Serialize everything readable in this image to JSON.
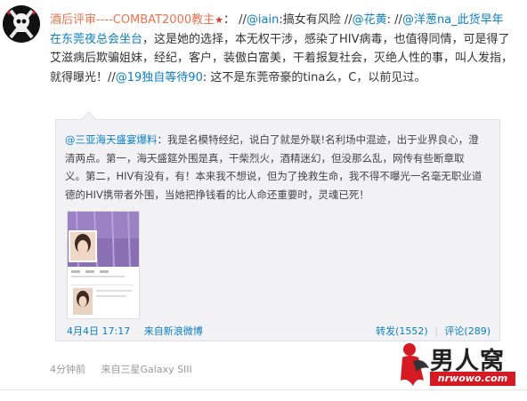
{
  "post": {
    "author": "酒后评审----COMBAT2000教主",
    "author_badge": "★",
    "colon": "：",
    "segments": [
      {
        "text": "//",
        "type": "plain"
      },
      {
        "text": "@iain",
        "type": "mention"
      },
      {
        "text": ":搞女有风险 //",
        "type": "plain"
      },
      {
        "text": "@花黄",
        "type": "mention"
      },
      {
        "text": ": //",
        "type": "plain"
      },
      {
        "text": "@洋葱na_此货早年在东莞夜总会坐台",
        "type": "mention"
      },
      {
        "text": "，这是她的选择，本无权干涉，感染了HIV病毒，也值得同情，可是得了艾滋病后欺骗姐妹，经纪，客户，装傲白富美，干着报复社会，灭绝人性的事，叫人发指，就得曝光！//",
        "type": "plain"
      },
      {
        "text": "@19独自等待90",
        "type": "mention"
      },
      {
        "text": ": 这不是东莞帝豪的tina么，C，以前见过。",
        "type": "plain"
      }
    ],
    "time": "4分钟前",
    "source": "来自三星Galaxy SIII"
  },
  "quoted": {
    "author": "@三亚海天盛宴爆料",
    "text": "：我是名模特经纪，说白了就是外联!名利场中混迹，出于业界良心，澄清两点。第一，海天盛筵外围是真，干柴烈火，酒精迷幻，但没那么乱，网传有些断章取义。第二，HIV有没有，有！本来我不想说，但为了挽救生命，我不得不曝光一名毫无职业道德的HIV携带者外围，当她把挣钱看的比人命还重要时，灵魂已死！",
    "time": "4月4日 17:17",
    "source": "来自新浪微博",
    "repost": "转发(1552)",
    "separator": "|",
    "comment": "评论(289)"
  },
  "watermark": {
    "title": "男人窝",
    "url": "nrwowo.com"
  },
  "colors": {
    "author": "#eb7350",
    "link": "#0a7fc4",
    "quote_bg": "#f2f2f5",
    "watermark_red": "#d51a24"
  }
}
